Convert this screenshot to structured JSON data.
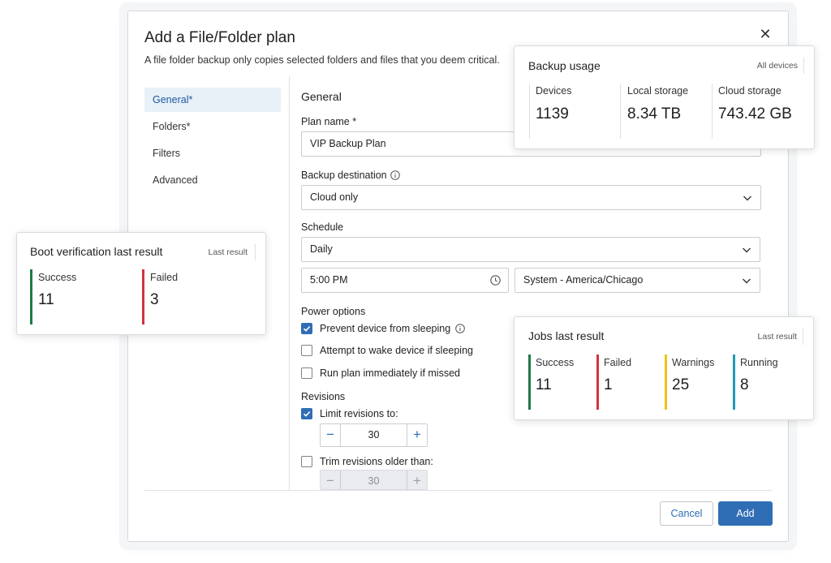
{
  "dialog": {
    "title": "Add a File/Folder plan",
    "subtitle": "A file folder backup only copies selected folders and files that you deem critical.",
    "close_icon": "close-icon",
    "nav": [
      {
        "label": "General*",
        "active": true
      },
      {
        "label": "Folders*",
        "active": false
      },
      {
        "label": "Filters",
        "active": false
      },
      {
        "label": "Advanced",
        "active": false
      }
    ],
    "form": {
      "section_title": "General",
      "plan_name_label": "Plan name *",
      "plan_name_value": "VIP Backup Plan",
      "backup_destination_label": "Backup destination",
      "backup_destination_value": "Cloud only",
      "schedule_label": "Schedule",
      "schedule_value": "Daily",
      "time_value": "5:00 PM",
      "timezone_value": "System - America/Chicago",
      "power_options_label": "Power options",
      "prevent_sleep_label": "Prevent device from sleeping",
      "prevent_sleep_checked": true,
      "wake_device_label": "Attempt to wake device if sleeping",
      "wake_device_checked": false,
      "run_missed_label": "Run plan immediately if missed",
      "run_missed_checked": false,
      "revisions_label": "Revisions",
      "limit_revisions_label": "Limit revisions to:",
      "limit_revisions_checked": true,
      "limit_revisions_value": "30",
      "trim_revisions_label": "Trim revisions older than:",
      "trim_revisions_checked": false,
      "trim_revisions_value": "30"
    },
    "buttons": {
      "cancel": "Cancel",
      "add": "Add"
    }
  },
  "backup_usage": {
    "title": "Backup usage",
    "tag": "All devices",
    "metrics": [
      {
        "label": "Devices",
        "value": "1139"
      },
      {
        "label": "Local storage",
        "value": "8.34 TB"
      },
      {
        "label": "Cloud storage",
        "value": "743.42 GB"
      }
    ]
  },
  "boot_verification": {
    "title": "Boot verification last result",
    "tag": "Last result",
    "metrics": [
      {
        "label": "Success",
        "value": "11",
        "color": "#1e7a45"
      },
      {
        "label": "Failed",
        "value": "3",
        "color": "#d0333f"
      }
    ]
  },
  "jobs": {
    "title": "Jobs last result",
    "tag": "Last result",
    "metrics": [
      {
        "label": "Success",
        "value": "11",
        "color": "#1e7a45"
      },
      {
        "label": "Failed",
        "value": "1",
        "color": "#d0333f"
      },
      {
        "label": "Warnings",
        "value": "25",
        "color": "#f2c21b"
      },
      {
        "label": "Running",
        "value": "8",
        "color": "#1f9bb3"
      }
    ]
  }
}
